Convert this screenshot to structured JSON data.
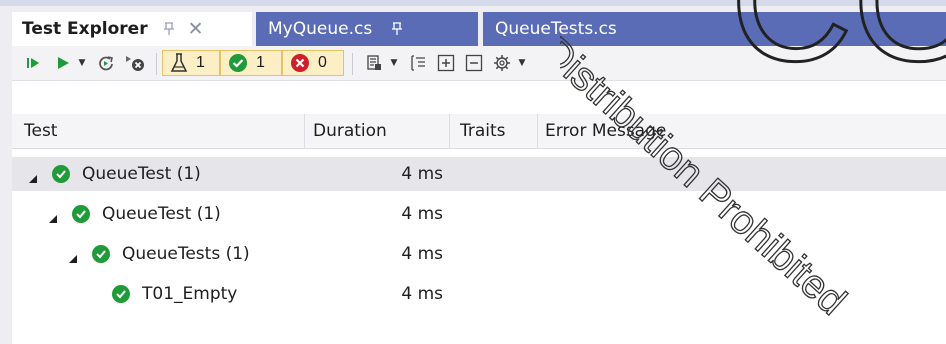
{
  "tabs": [
    {
      "title": "Test Explorer",
      "active": true
    },
    {
      "title": "MyQueue.cs",
      "active": false
    },
    {
      "title": "QueueTests.cs",
      "active": false
    }
  ],
  "toolbar": {
    "run_all_icon": "run-all-icon",
    "run_icon": "run-icon",
    "repeat_icon": "repeat-last-run-icon",
    "cancel_icon": "cancel-run-icon",
    "total_count": "1",
    "passed_count": "1",
    "failed_count": "0",
    "playlist_icon": "playlist-icon",
    "group_icon": "group-by-icon",
    "expand_icon": "expand-all-icon",
    "collapse_icon": "collapse-all-icon",
    "settings_icon": "settings-gear-icon"
  },
  "columns": {
    "test": "Test",
    "duration": "Duration",
    "traits": "Traits",
    "error": "Error Message"
  },
  "rows": [
    {
      "name": "QueueTest (1)",
      "duration": "4 ms"
    },
    {
      "name": "QueueTest (1)",
      "duration": "4 ms"
    },
    {
      "name": "QueueTests (1)",
      "duration": "4 ms"
    },
    {
      "name": "T01_Empty",
      "duration": "4 ms"
    }
  ],
  "watermark": "Distribution Prohibited",
  "colors": {
    "accent": "#5b6cb6",
    "pass": "#1f9b3a",
    "fail": "#d01f2b",
    "count_bg": "#fcefc5"
  }
}
